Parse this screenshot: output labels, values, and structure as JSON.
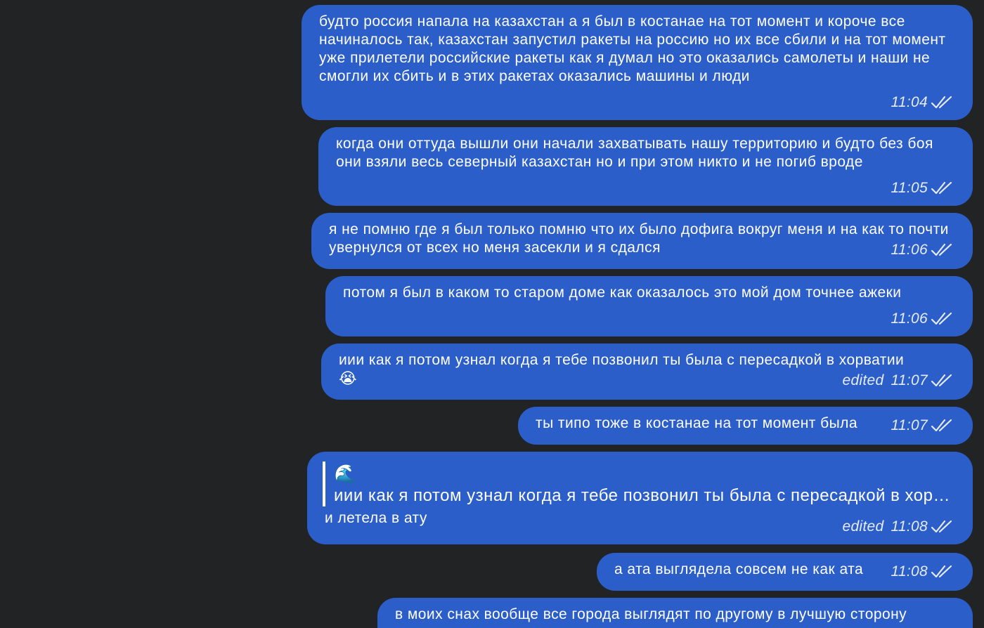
{
  "messages": [
    {
      "text": "будто россия напала на казахстан а я был в костанае на тот момент и короче все начиналось так, казахстан запустил ракеты на россию но их все сбили и на тот момент уже прилетели российские ракеты как я думал но это оказались самолеты и наши не смогли их сбить и в этих ракетах оказались машины и люди",
      "time": "11:04"
    },
    {
      "text": "когда они оттуда вышли они начали захватывать нашу территорию и будто без боя они взяли весь северный казахстан но и при этом никто и не погиб вроде",
      "time": "11:05"
    },
    {
      "text": "я не помню где я был только помню что их было дофига вокруг меня и на как то почти увернулся от всех но меня засекли и я сдался",
      "time": "11:06"
    },
    {
      "text": "потом я был в каком то старом доме как оказалось это мой дом точнее ажеки",
      "time": "11:06"
    },
    {
      "text": "иии как я потом узнал когда я тебе позвонил ты была с пересадкой в хорватии",
      "emoji": "😭",
      "edited": "edited",
      "time": "11:07"
    },
    {
      "text": "ты типо тоже в костанае на тот момент была",
      "time": "11:07"
    },
    {
      "reply_emoji": "🌊",
      "reply_text": "иии как я потом узнал когда я тебе позвонил ты была с пересадкой в хорватии",
      "text": "и летела в ату",
      "edited": "edited",
      "time": "11:08"
    },
    {
      "text": "а ата выглядела совсем не как ата",
      "time": "11:08"
    },
    {
      "text": "в моих снах вообще все города выглядят по другому в лучшую сторону"
    }
  ],
  "colors": {
    "background": "#212325",
    "bubble": "#2b5ec9",
    "text": "#ffffff"
  },
  "icons": {
    "read_receipt": "double-check-icon"
  }
}
